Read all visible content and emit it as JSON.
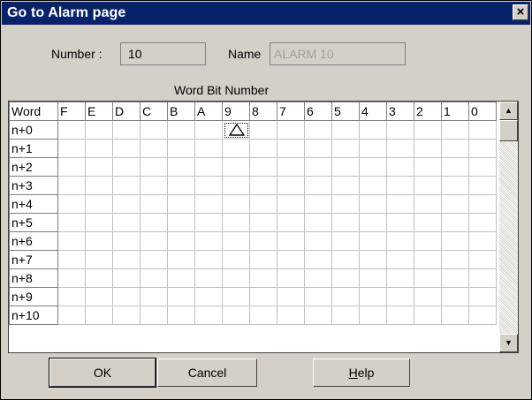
{
  "window": {
    "title": "Go to Alarm page"
  },
  "fields": {
    "number_label": "Number :",
    "number_value": "10",
    "name_label": "Name",
    "name_value": "ALARM 10"
  },
  "grid": {
    "caption": "Word Bit Number",
    "corner_label": "Word",
    "columns": [
      "F",
      "E",
      "D",
      "C",
      "B",
      "A",
      "9",
      "8",
      "7",
      "6",
      "5",
      "4",
      "3",
      "2",
      "1",
      "0"
    ],
    "rows": [
      "n+0",
      "n+1",
      "n+2",
      "n+3",
      "n+4",
      "n+5",
      "n+6",
      "n+7",
      "n+8",
      "n+9",
      "n+10"
    ],
    "marked_cell": {
      "row": "n+0",
      "bit": "9",
      "icon": "alarm-triangle-icon"
    }
  },
  "buttons": {
    "ok": "OK",
    "cancel": "Cancel",
    "help_pre": "",
    "help_underlined": "H",
    "help_post": "elp"
  }
}
